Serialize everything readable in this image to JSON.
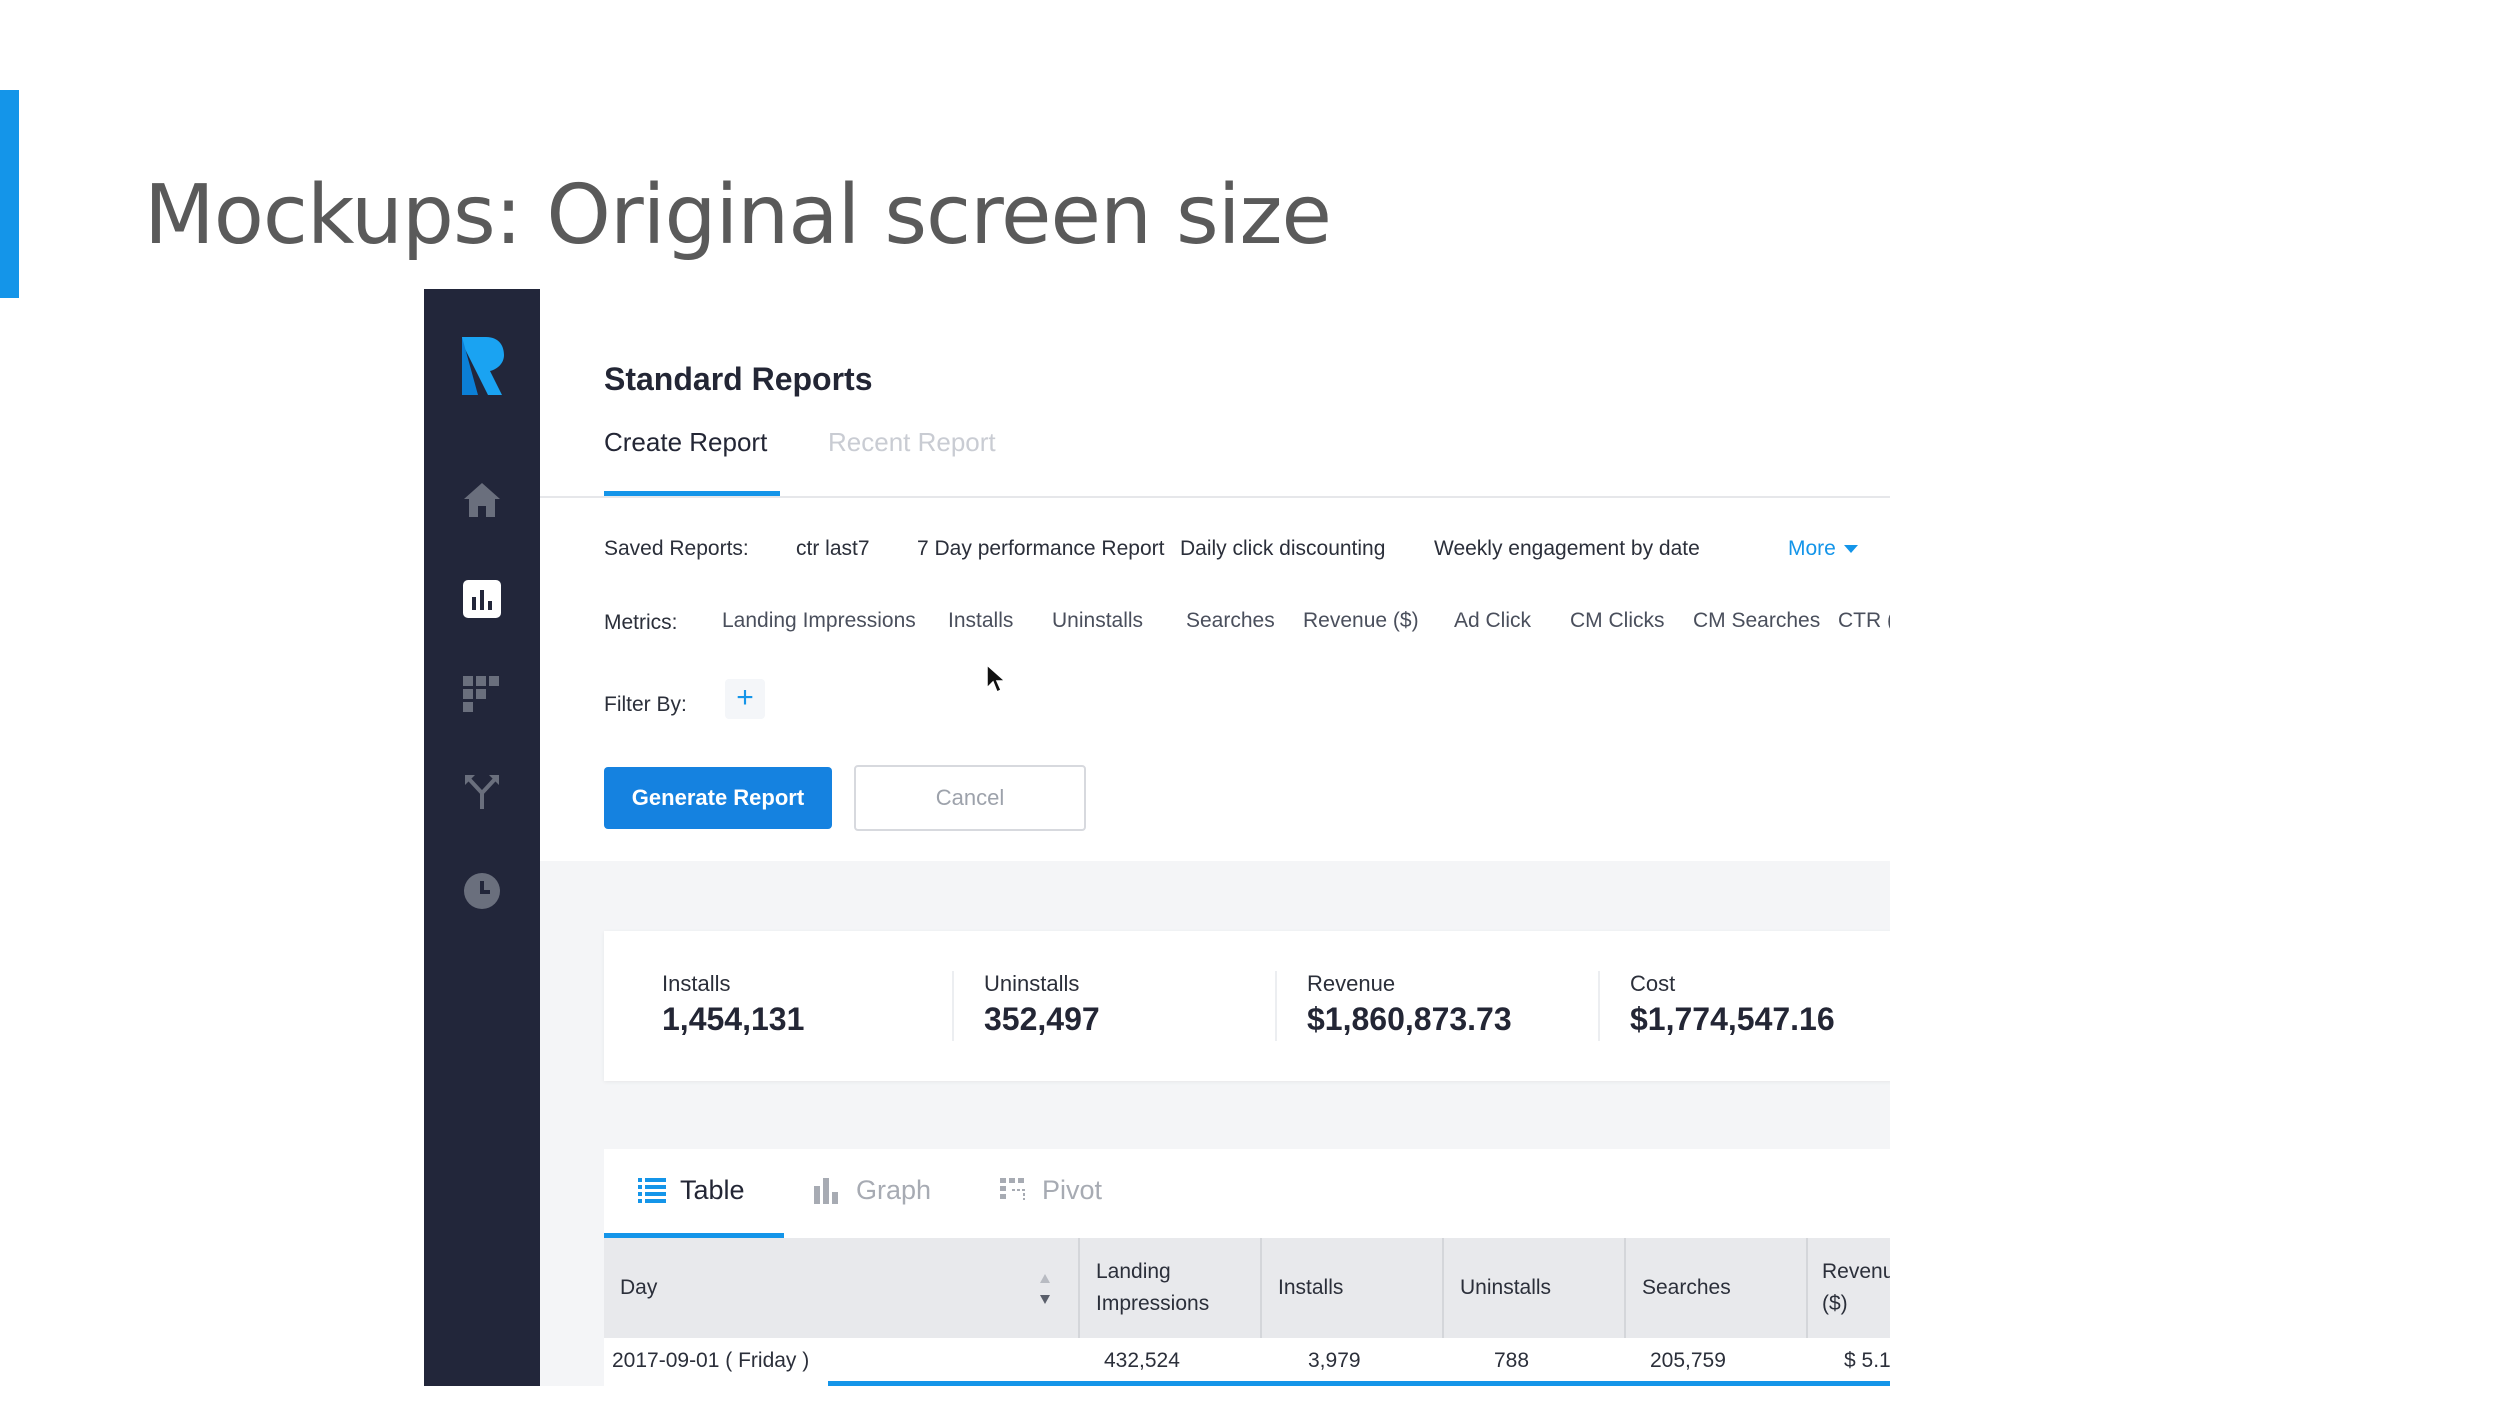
{
  "slide": {
    "title": "Mockups: Original screen size"
  },
  "colors": {
    "accent": "#1495e9",
    "nav_bg": "#22263a",
    "primary_button": "#1582e0"
  },
  "nav": {
    "logo": "R",
    "items": [
      {
        "icon": "home-icon",
        "active": false
      },
      {
        "icon": "bar-chart-icon",
        "active": true
      },
      {
        "icon": "grid-icon",
        "active": false
      },
      {
        "icon": "split-arrows-icon",
        "active": false
      },
      {
        "icon": "clock-icon",
        "active": false
      }
    ]
  },
  "page": {
    "title": "Standard Reports",
    "tabs": [
      {
        "label": "Create Report",
        "active": true
      },
      {
        "label": "Recent Report",
        "active": false
      }
    ]
  },
  "saved_reports": {
    "label": "Saved Reports:",
    "items": [
      "ctr last7",
      "7 Day performance Report",
      "Daily click discounting",
      "Weekly engagement by date"
    ],
    "more_label": "More"
  },
  "metrics": {
    "label": "Metrics:",
    "items": [
      "Landing Impressions",
      "Installs",
      "Uninstalls",
      "Searches",
      "Revenue ($)",
      "Ad Click",
      "CM Clicks",
      "CM Searches",
      "CTR ("
    ]
  },
  "filter": {
    "label": "Filter By:",
    "add_label": "+"
  },
  "buttons": {
    "generate": "Generate Report",
    "cancel": "Cancel"
  },
  "stats": [
    {
      "label": "Installs",
      "value": "1,454,131"
    },
    {
      "label": "Uninstalls",
      "value": "352,497"
    },
    {
      "label": "Revenue",
      "value": "$1,860,873.73"
    },
    {
      "label": "Cost",
      "value": "$1,774,547.16"
    }
  ],
  "view_tabs": [
    {
      "label": "Table",
      "icon": "list-icon",
      "active": true
    },
    {
      "label": "Graph",
      "icon": "bar-chart-icon",
      "active": false
    },
    {
      "label": "Pivot",
      "icon": "pivot-icon",
      "active": false
    }
  ],
  "table": {
    "columns": [
      "Day",
      "Landing Impressions",
      "Installs",
      "Uninstalls",
      "Searches",
      "Revenue ($)"
    ],
    "rows": [
      [
        "2017-09-01 ( Friday )",
        "432,524",
        "3,979",
        "788",
        "205,759",
        "$ 5.1"
      ]
    ]
  }
}
